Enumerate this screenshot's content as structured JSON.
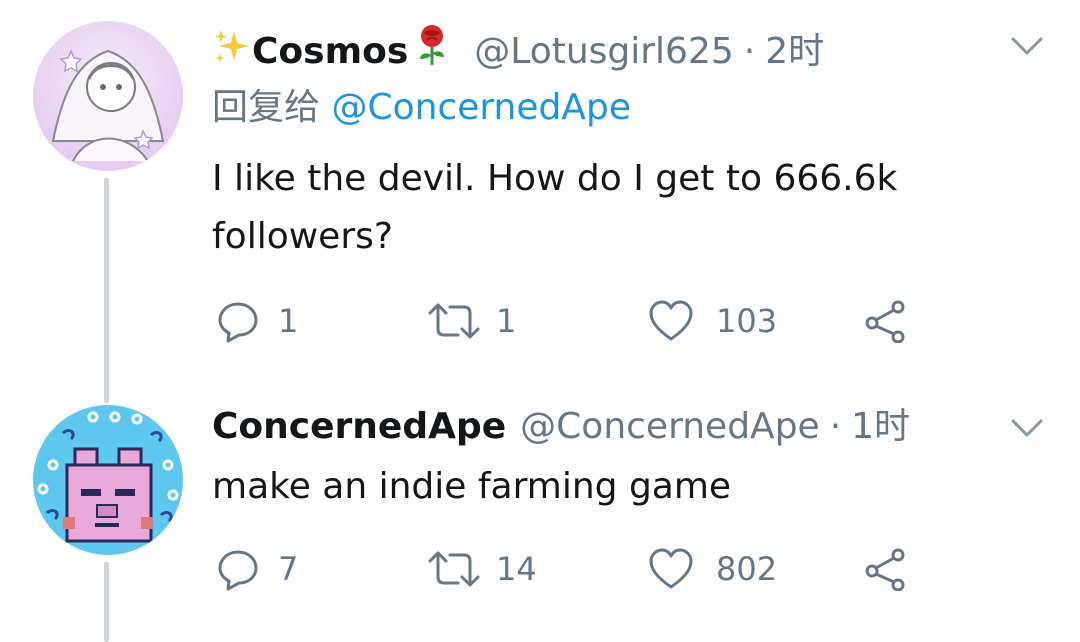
{
  "tweets": [
    {
      "display_name": "Cosmos",
      "name_prefix_emoji": "sparkles",
      "name_suffix_emoji": "rose",
      "handle": "@Lotusgirl625",
      "separator": "·",
      "time": "2时",
      "reply_prefix": "回复给",
      "reply_to": "@ConcernedApe",
      "text": "I like the devil. How do I get to 666.6k followers?",
      "replies": "1",
      "retweets": "1",
      "likes": "103"
    },
    {
      "display_name": "ConcernedApe",
      "handle": "@ConcernedApe",
      "separator": "·",
      "time": "1时",
      "text": "make an indie farming game",
      "replies": "7",
      "retweets": "14",
      "likes": "802"
    }
  ],
  "colors": {
    "text": "#14171a",
    "secondary": "#657786",
    "link": "#1b95e0",
    "thread_line": "#cfd6dc"
  },
  "icons": [
    "reply-icon",
    "retweet-icon",
    "like-icon",
    "share-icon",
    "chevron-down-icon"
  ]
}
